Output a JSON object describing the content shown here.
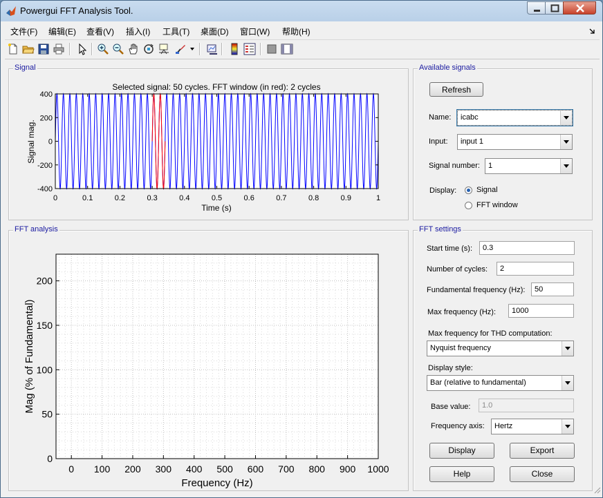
{
  "window": {
    "title": "Powergui FFT Analysis Tool."
  },
  "menu": [
    "文件(F)",
    "编辑(E)",
    "查看(V)",
    "插入(I)",
    "工具(T)",
    "桌面(D)",
    "窗口(W)",
    "帮助(H)"
  ],
  "toolbar": {
    "icons": [
      "new-file-icon",
      "open-folder-icon",
      "save-icon",
      "print-icon",
      "pointer-icon",
      "zoom-in-icon",
      "zoom-out-icon",
      "pan-icon",
      "rotate-3d-icon",
      "data-cursor-icon",
      "brush-icon",
      "link-plot-icon",
      "colorbar-icon",
      "legend-icon",
      "hide-plot-tools-icon",
      "show-plot-tools-icon"
    ]
  },
  "signal_panel": {
    "label": "Signal",
    "plot": {
      "title": "Selected signal: 50 cycles. FFT window (in red): 2 cycles",
      "ylabel": "Signal mag.",
      "xlabel": "Time (s)"
    }
  },
  "fft_panel": {
    "label": "FFT analysis",
    "plot": {
      "ylabel": "Mag (% of Fundamental)",
      "xlabel": "Frequency (Hz)"
    }
  },
  "available_signals": {
    "label": "Available signals",
    "refresh": "Refresh",
    "name_label": "Name:",
    "name_value": "icabc",
    "input_label": "Input:",
    "input_value": "input 1",
    "signal_number_label": "Signal number:",
    "signal_number_value": "1",
    "display_label": "Display:",
    "display_options": [
      "Signal",
      "FFT window"
    ],
    "display_selected": "Signal"
  },
  "fft_settings": {
    "label": "FFT settings",
    "start_time_label": "Start time (s):",
    "start_time_value": "0.3",
    "cycles_label": "Number of cycles:",
    "cycles_value": "2",
    "fund_freq_label": "Fundamental frequency (Hz):",
    "fund_freq_value": "50",
    "max_freq_label": "Max frequency (Hz):",
    "max_freq_value": "1000",
    "thd_label": "Max frequency for THD computation:",
    "thd_value": "Nyquist frequency",
    "display_style_label": "Display style:",
    "display_style_value": "Bar (relative to fundamental)",
    "base_value_label": "Base value:",
    "base_value_value": "1.0",
    "freq_axis_label": "Frequency axis:",
    "freq_axis_value": "Hertz",
    "buttons": {
      "display": "Display",
      "export": "Export",
      "help": "Help",
      "close": "Close"
    }
  },
  "chart_data": [
    {
      "type": "line",
      "title": "Selected signal: 50 cycles. FFT window (in red): 2 cycles",
      "xlabel": "Time (s)",
      "ylabel": "Signal mag.",
      "xlim": [
        0,
        1
      ],
      "ylim": [
        -400,
        400
      ],
      "xticks": [
        0,
        0.1,
        0.2,
        0.3,
        0.4,
        0.5,
        0.6,
        0.7,
        0.8,
        0.9,
        1
      ],
      "yticks": [
        -400,
        -200,
        0,
        200,
        400
      ],
      "series": [
        {
          "color": "#0000ff",
          "function": "sine",
          "amplitude": 400,
          "frequency_hz": 50,
          "x_range": [
            0,
            1
          ]
        },
        {
          "color": "#ff0000",
          "function": "sine",
          "amplitude": 400,
          "frequency_hz": 50,
          "x_range": [
            0.3,
            0.34
          ]
        }
      ],
      "grid": false
    },
    {
      "type": "bar",
      "xlabel": "Frequency (Hz)",
      "ylabel": "Mag (% of Fundamental)",
      "xlim": [
        -50,
        1000
      ],
      "ylim": [
        0,
        230
      ],
      "xticks": [
        0,
        100,
        200,
        300,
        400,
        500,
        600,
        700,
        800,
        900,
        1000
      ],
      "yticks": [
        0,
        50,
        100,
        150,
        200
      ],
      "series": [],
      "grid": true
    }
  ]
}
